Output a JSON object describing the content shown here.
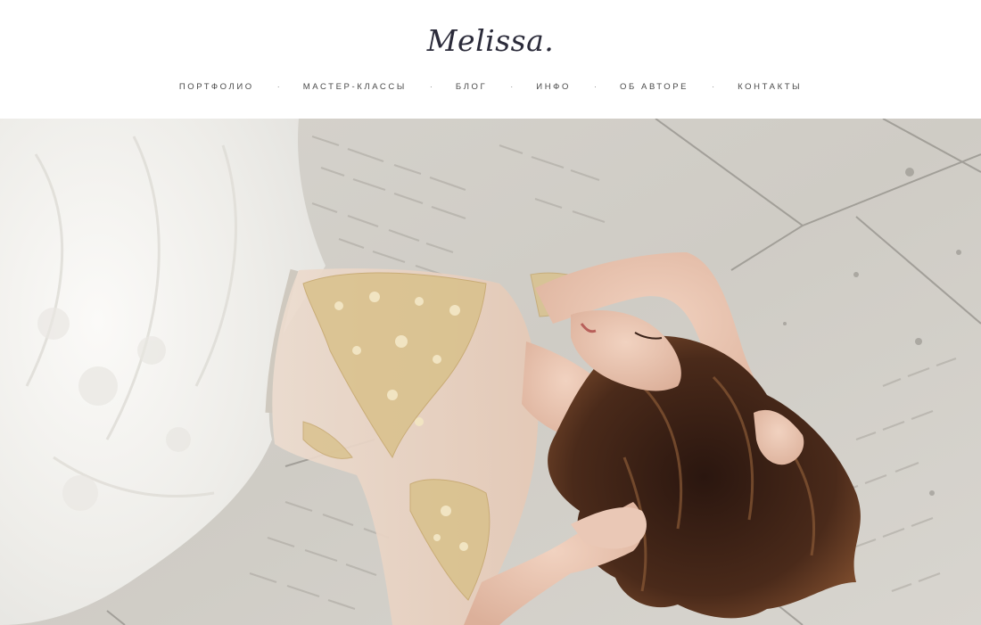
{
  "site": {
    "logo": "Melissa."
  },
  "nav": {
    "items": [
      {
        "label": "ПОРТФОЛИО"
      },
      {
        "label": "МАСТЕР-КЛАССЫ"
      },
      {
        "label": "БЛОГ"
      },
      {
        "label": "ИНФО"
      },
      {
        "label": "ОБ АВТОРЕ"
      },
      {
        "label": "КОНТАКТЫ"
      }
    ],
    "separator": "·"
  },
  "hero": {
    "image_subject": "bride-lying-on-stone-floor-photo",
    "colors": {
      "stone": "#d4d1cb",
      "dress": "#f2f1ee",
      "hair": "#3a2218",
      "skin": "#e8c4b0",
      "embroidery": "#d8c08a"
    }
  }
}
